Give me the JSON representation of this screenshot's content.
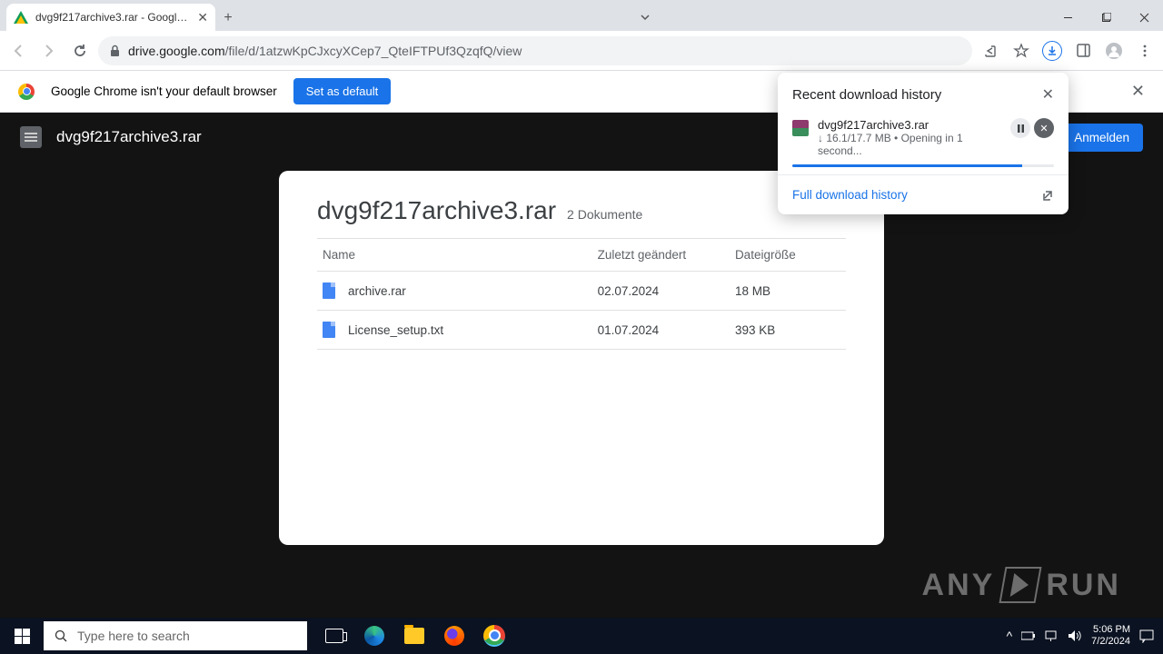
{
  "browser": {
    "tab_title": "dvg9f217archive3.rar - Google D",
    "url_host": "drive.google.com",
    "url_path": "/file/d/1atzwKpCJxcyXCep7_QteIFTPUf3QzqfQ/view"
  },
  "infobar": {
    "text": "Google Chrome isn't your default browser",
    "button": "Set as default"
  },
  "drive": {
    "filename": "dvg9f217archive3.rar",
    "signin": "Anmelden",
    "card_title": "dvg9f217archive3.rar",
    "card_sub": "2 Dokumente",
    "cols": {
      "name": "Name",
      "modified": "Zuletzt geändert",
      "size": "Dateigröße"
    },
    "files": [
      {
        "name": "archive.rar",
        "modified": "02.07.2024",
        "size": "18 MB"
      },
      {
        "name": "License_setup.txt",
        "modified": "01.07.2024",
        "size": "393 KB"
      }
    ]
  },
  "download": {
    "header": "Recent download history",
    "item_name": "dvg9f217archive3.rar",
    "item_info": "↓ 16.1/17.7 MB • Opening in 1 second...",
    "full": "Full download history"
  },
  "taskbar": {
    "search_placeholder": "Type here to search",
    "time": "5:06 PM",
    "date": "7/2/2024"
  },
  "watermark": {
    "a": "ANY",
    "b": "RUN"
  }
}
